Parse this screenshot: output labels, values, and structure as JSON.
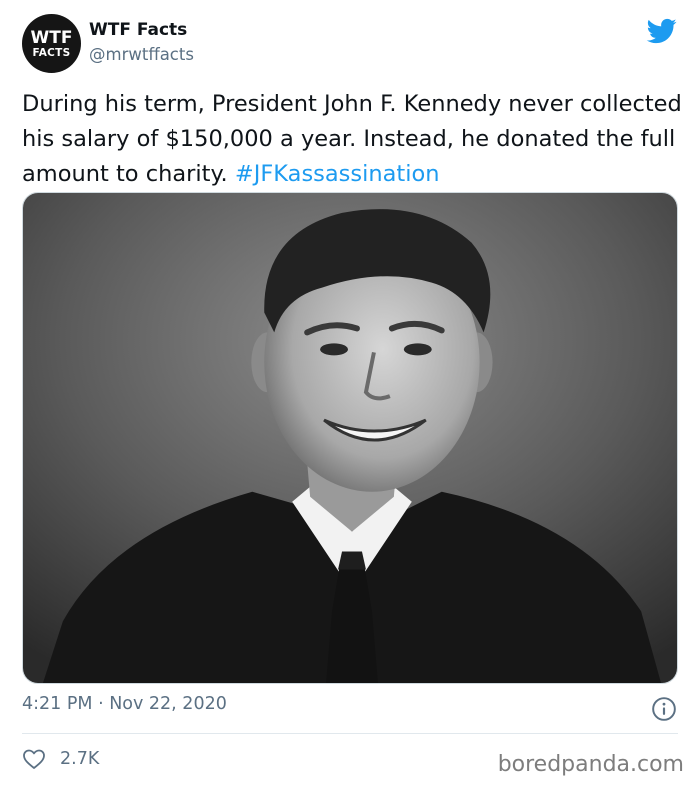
{
  "account": {
    "avatar_line1": "WTF",
    "avatar_line2": "FACTS",
    "display_name": "WTF Facts",
    "handle": "@mrwtffacts"
  },
  "tweet": {
    "text": "During his term, President John F. Kennedy never collected his salary of $150,000 a year. Instead, he donated the full amount to charity.",
    "hashtag": "#JFKassassination",
    "image_description": "black-and-white portrait photo",
    "timestamp": "4:21 PM · Nov 22, 2020",
    "likes": "2.7K"
  },
  "icons": {
    "brand": "twitter-bird-icon",
    "info": "info-icon",
    "like": "heart-icon"
  },
  "colors": {
    "link": "#1d9bf0",
    "twitter_blue": "#1d9bf0",
    "muted": "#5b7083"
  },
  "watermark": "boredpanda.com"
}
